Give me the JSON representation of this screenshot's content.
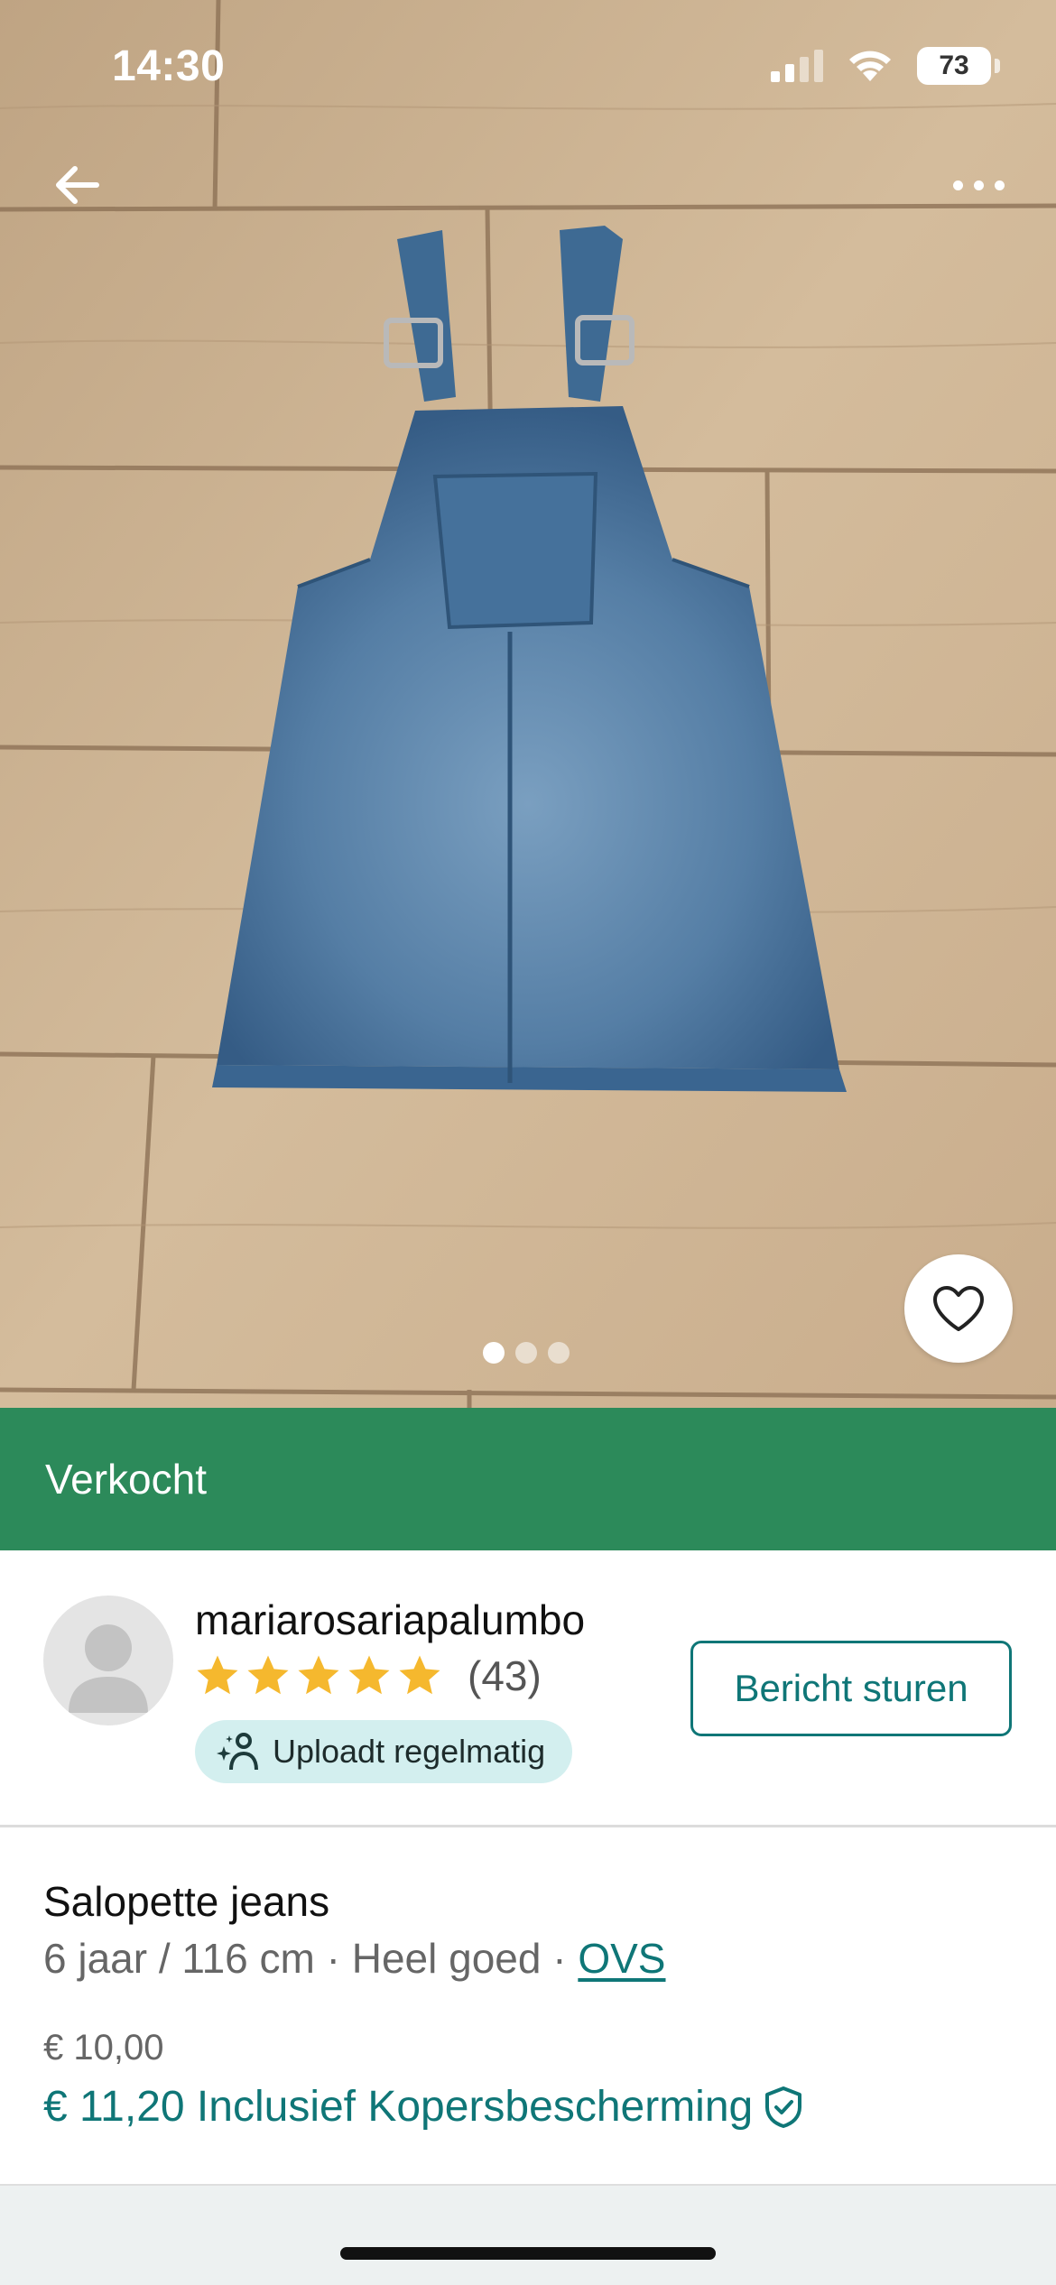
{
  "status_bar": {
    "time": "14:30",
    "battery": "73"
  },
  "photo": {
    "page_indicator": {
      "total": 3,
      "active": 1
    }
  },
  "sold_banner": {
    "label": "Verkocht"
  },
  "seller": {
    "username": "mariarosariapalumbo",
    "rating_stars": 5,
    "rating_count": "(43)",
    "badge": "Uploadt regelmatig",
    "message_button": "Bericht sturen"
  },
  "item": {
    "title": "Salopette jeans",
    "size": "6 jaar / 116 cm",
    "separator": " · ",
    "condition": "Heel goed",
    "brand": "OVS",
    "price": "€ 10,00",
    "price_with_protection": "€ 11,20 Inclusief Kopersbescherming"
  },
  "colors": {
    "sold_green": "#2c8a5a",
    "accent_teal": "#0f7677",
    "star_yellow": "#f5b82e",
    "badge_bg": "#d3efef"
  },
  "icons": {
    "back": "arrow-left-icon",
    "more": "more-dots-icon",
    "favorite": "heart-icon",
    "badge": "upload-sparkle-icon",
    "protection": "shield-check-icon"
  }
}
